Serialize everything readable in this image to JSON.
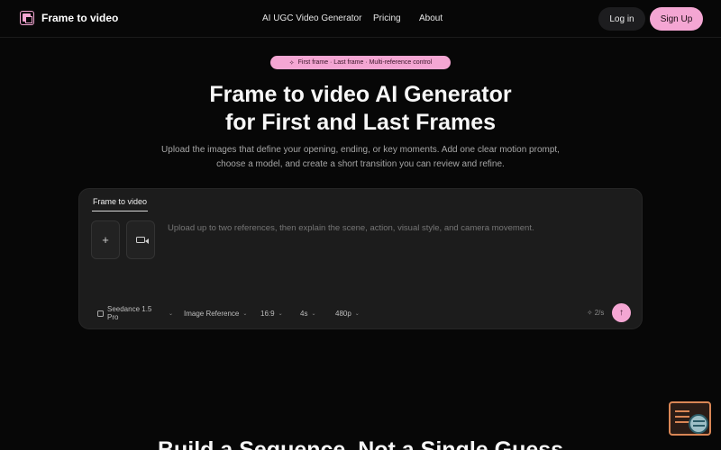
{
  "header": {
    "brand": "Frame to video",
    "nav": [
      "AI UGC Video Generator",
      "Pricing",
      "About"
    ],
    "login": "Log in",
    "signup": "Sign Up"
  },
  "hero": {
    "badge": "First frame · Last frame · Multi-reference control",
    "title_line1": "Frame to video AI Generator",
    "title_line2": "for First and Last Frames",
    "subtitle_line1": "Upload the images that define your opening, ending, or key moments. Add one clear motion prompt,",
    "subtitle_line2": "choose a model, and create a short transition you can review and refine."
  },
  "composer": {
    "tab": "Frame to video",
    "add_label": "+",
    "placeholder": "Upload up to two references, then explain the scene, action, visual style, and camera movement.",
    "options": {
      "model": "Seedance 1.5 Pro",
      "reference": "Image Reference",
      "ratio": "16:9",
      "duration": "4s",
      "resolution": "480p"
    },
    "credits": "2/s",
    "send": "↑"
  },
  "next_section": {
    "heading": "Build a Sequence, Not a Single Guess"
  },
  "colors": {
    "accent": "#f4a6d3",
    "background": "#070707",
    "panel": "#1c1c1c"
  },
  "icons": {
    "logo": "film-frame-icon",
    "video": "video-camera-icon",
    "model": "chip-icon",
    "credits": "spark-icon",
    "send": "arrow-up-icon",
    "helper": "search-document-icon"
  }
}
